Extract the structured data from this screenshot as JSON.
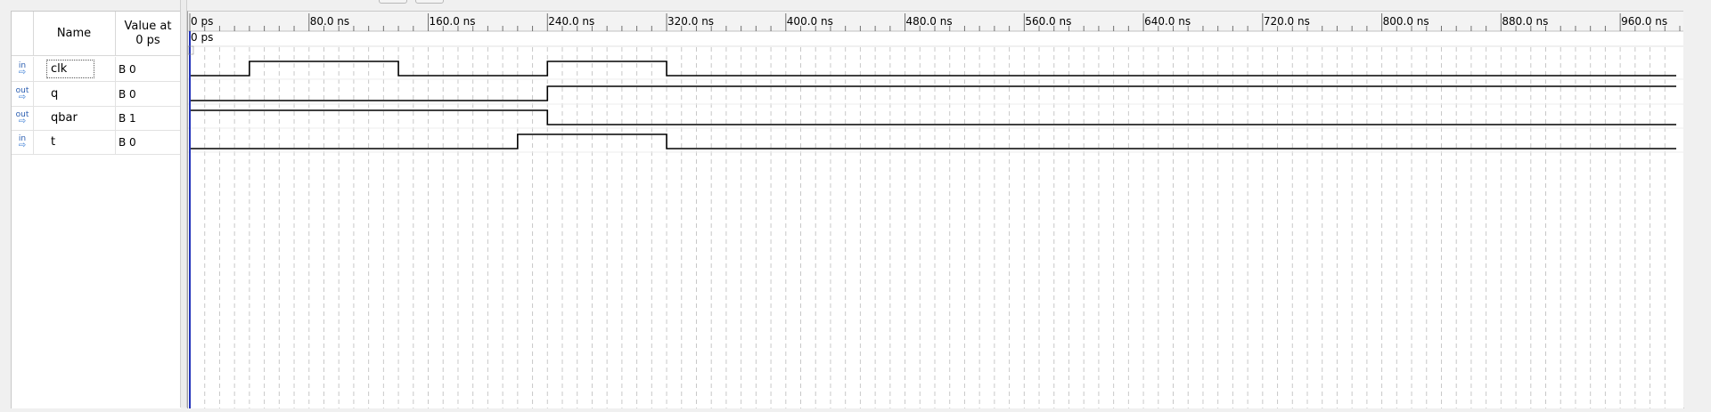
{
  "columns": {
    "name": "Name",
    "value": "Value at\n0 ps",
    "value_l1": "Value at",
    "value_l2": "0 ps"
  },
  "signals": [
    {
      "dir": "in",
      "name": "clk",
      "value": "B 0",
      "transitions": [
        [
          0,
          0
        ],
        [
          40,
          1
        ],
        [
          140,
          0
        ],
        [
          240,
          1
        ],
        [
          320,
          0
        ]
      ]
    },
    {
      "dir": "out",
      "name": "q",
      "value": "B 0",
      "transitions": [
        [
          0,
          0
        ],
        [
          240,
          1
        ]
      ]
    },
    {
      "dir": "out",
      "name": "qbar",
      "value": "B 1",
      "transitions": [
        [
          0,
          1
        ],
        [
          240,
          0
        ]
      ]
    },
    {
      "dir": "in",
      "name": "t",
      "value": "B 0",
      "transitions": [
        [
          0,
          0
        ],
        [
          220,
          1
        ],
        [
          320,
          0
        ]
      ]
    }
  ],
  "timeline": {
    "unit": "ns",
    "end": 1000,
    "major_tick_step": 80,
    "labels": [
      "0 ps",
      "80.0 ns",
      "160.0 ns",
      "240.0 ns",
      "320.0 ns",
      "400.0 ns",
      "480.0 ns",
      "560.0 ns",
      "640.0 ns",
      "720.0 ns",
      "800.0 ns",
      "880.0 ns",
      "960.0 ns"
    ],
    "cursor_label": "0 ps",
    "cursor_time": 0
  },
  "colors": {
    "cursor": "#2233bb",
    "wave": "#000000",
    "grid": "#c8c8c8",
    "ruler_bg": "#f3f3f3"
  }
}
